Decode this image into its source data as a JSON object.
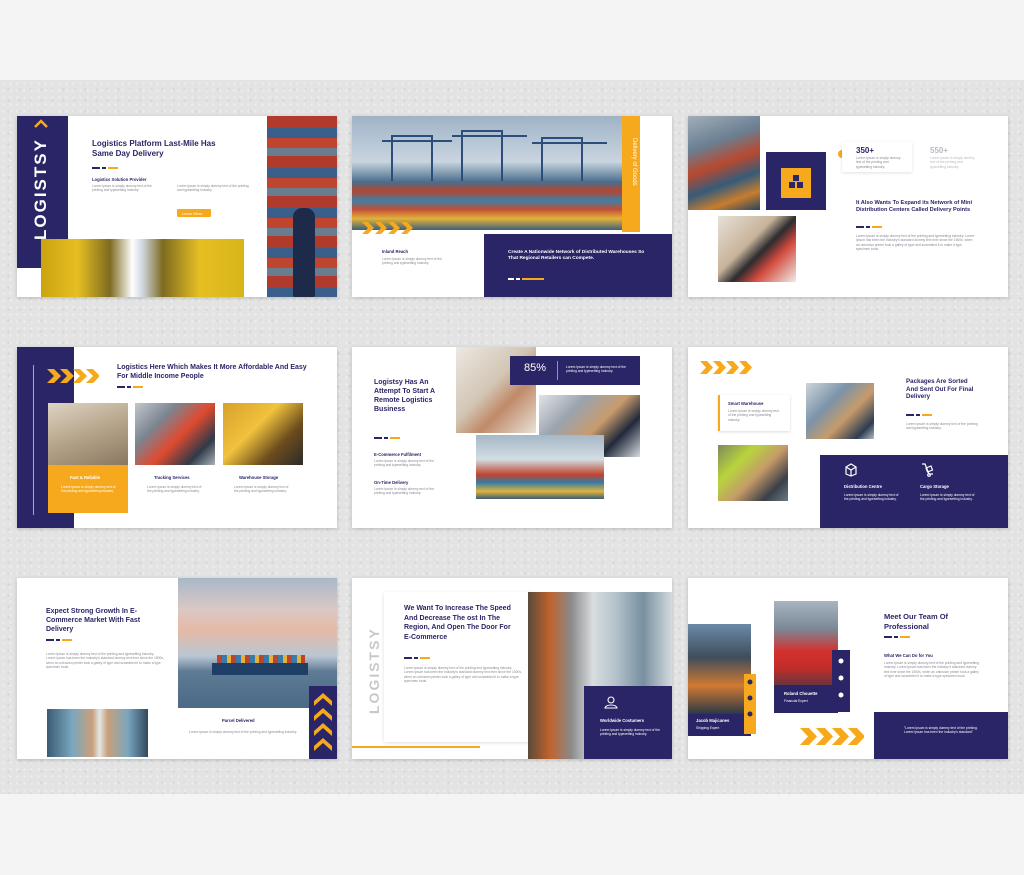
{
  "brand_name": "LOGISTSY",
  "colors": {
    "navy": "#2a2566",
    "accent": "#f6a91c",
    "background": "#e3e3e3"
  },
  "lorem_short": "Lorem Ipsum is simply dummy text of the printing and typesetting industry.",
  "lorem_long": "Lorem Ipsum is simply dummy text of the printing and typesetting industry. Lorem Ipsum has been the industry's standard dummy text ever since the 1500s, when an unknown printer took a galley of type and scrambled it to make a type specimen book.",
  "slides": {
    "s1": {
      "title": "Logistics Platform Last-Mile Has Same Day Delivery",
      "subtitle": "Logistics Solution Provider",
      "button": "Learn More"
    },
    "s2": {
      "vertical_label": "Delivery of Goods",
      "subtitle": "Inland Reach",
      "box_title": "Create A Nationwide Network of Distributed Warehouses So That Regional Retailers can Compete."
    },
    "s3": {
      "stat1_value": "350+",
      "stat2_value": "550+",
      "title": "It Also Wants To Expand its Network of Mini Distribution Centers Called Delivery Points"
    },
    "s4": {
      "title": "Logistics Here Which Makes It More Affordable And Easy For Middle Income People",
      "cards": [
        "Fast & Reliable",
        "Tracking Services",
        "Warehouse Storage"
      ]
    },
    "s5": {
      "title": "Logistsy Has An Attempt To Start A Remote Logistics Business",
      "stat_value": "85%",
      "items": [
        "E-Commerce Fulfilment",
        "On-Time Delivery"
      ]
    },
    "s6": {
      "title": "Packages Are Sorted And Sent Out For Final Delivery",
      "card_title": "Smart Warehouse",
      "features": [
        "Distribution Centre",
        "Cargo Storage"
      ]
    },
    "s7": {
      "title": "Expect Strong Growth In E-Commerce Market With Fast Delivery",
      "caption": "Parcel Delivered"
    },
    "s8": {
      "title": "We Want To Increase The Speed And Decrease The ost In The Region, And Open The Door For E-Commerce",
      "box_title": "Worldwide Costumers"
    },
    "s9": {
      "title": "Meet Our Team Of Professional",
      "subtitle": "What We Can Do for You",
      "people": [
        {
          "name": "Jacob Majicanes",
          "role": "Shipping Expert"
        },
        {
          "name": "Roland Chouette",
          "role": "Financial Expert"
        }
      ],
      "quote": "\"Lorem Ipsum is simply dummy text of the printing. Lorem Ipsum has been the industry's standard\""
    }
  }
}
